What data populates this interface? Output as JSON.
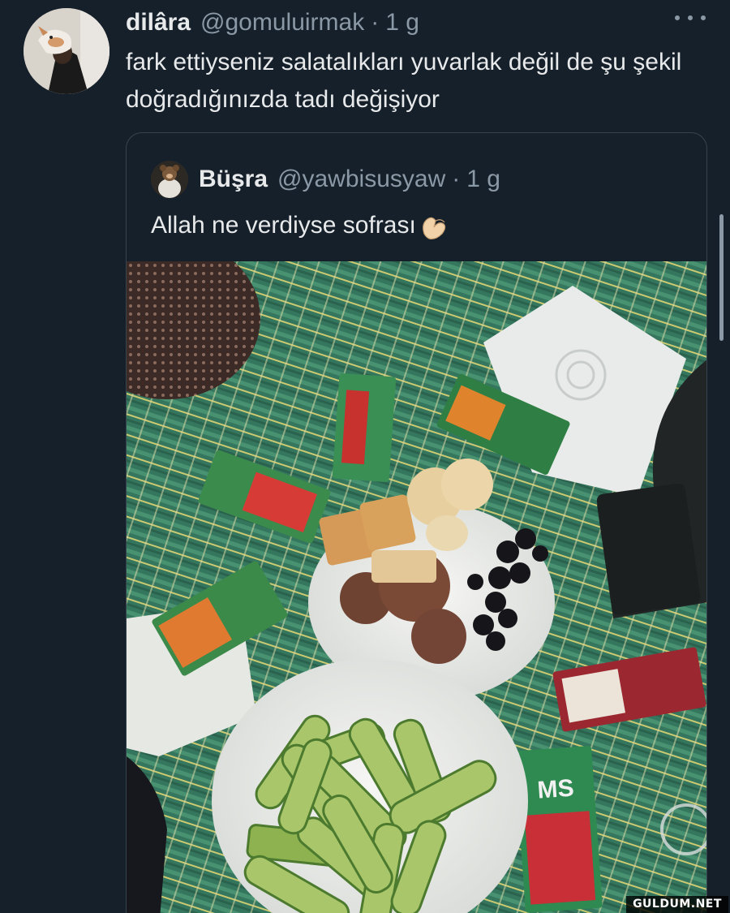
{
  "tweet": {
    "display_name": "dilâra",
    "handle": "@gomuluirmak",
    "separator": "·",
    "time": "1 g",
    "text": "fark ettiyseniz salatalıkları yuvarlak değil de şu şekil doğradığınızda tadı değişiyor",
    "more_icon": "more-horizontal-icon"
  },
  "quoted_tweet": {
    "display_name": "Büşra",
    "handle": "@yawbisusyaw",
    "separator": "·",
    "time": "1 g",
    "text": "Allah ne verdiyse sofrası",
    "emoji_icon": "pinching-hand-icon"
  },
  "photo": {
    "juice_box_label": "MS"
  },
  "watermark": "GULDUM.NET",
  "colors": {
    "background": "#15202b",
    "primary_text": "#e7e9ea",
    "secondary_text": "#8b98a5",
    "border": "#38444d"
  }
}
